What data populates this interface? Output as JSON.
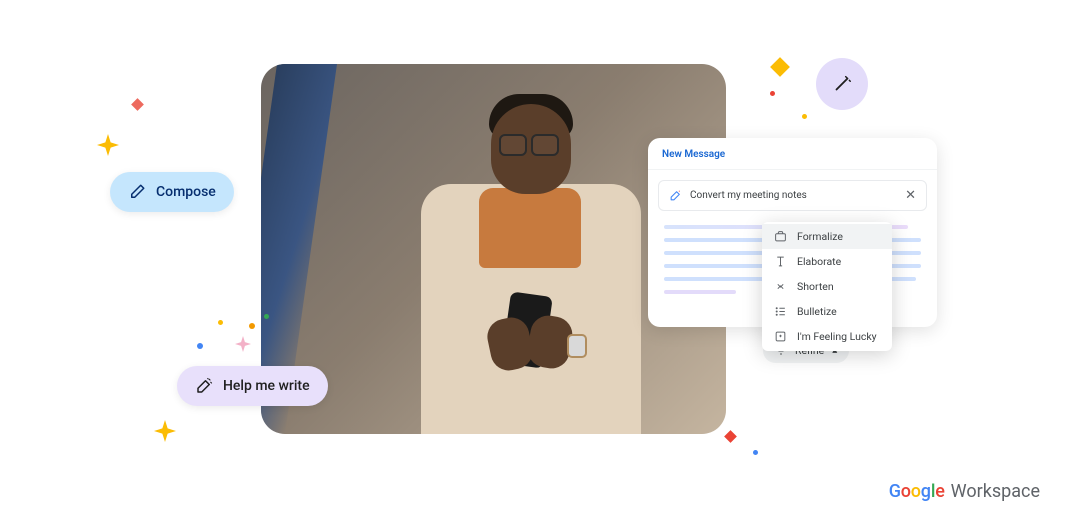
{
  "chips": {
    "compose": "Compose",
    "help_me_write": "Help me write"
  },
  "message_card": {
    "title": "New Message",
    "prompt": "Convert my meeting notes"
  },
  "refine_menu": {
    "items": [
      {
        "label": "Formalize",
        "icon": "briefcase"
      },
      {
        "label": "Elaborate",
        "icon": "text-height"
      },
      {
        "label": "Shorten",
        "icon": "collapse"
      },
      {
        "label": "Bulletize",
        "icon": "list"
      },
      {
        "label": "I'm Feeling Lucky",
        "icon": "sparkle-box"
      }
    ],
    "anchor_label": "Refine"
  },
  "brand": {
    "google": "Google",
    "workspace": "Workspace"
  }
}
